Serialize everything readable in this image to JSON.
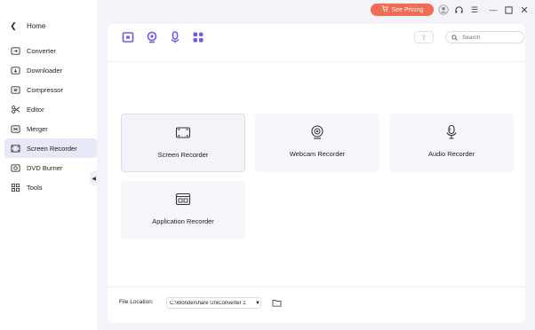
{
  "sidebar": {
    "home_label": "Home",
    "items": [
      {
        "label": "Converter",
        "icon": "converter-icon"
      },
      {
        "label": "Downloader",
        "icon": "downloader-icon"
      },
      {
        "label": "Compressor",
        "icon": "compressor-icon"
      },
      {
        "label": "Editor",
        "icon": "editor-icon"
      },
      {
        "label": "Merger",
        "icon": "merger-icon"
      },
      {
        "label": "Screen Recorder",
        "icon": "screen-recorder-icon",
        "active": true
      },
      {
        "label": "DVD Burner",
        "icon": "dvd-burner-icon"
      },
      {
        "label": "Tools",
        "icon": "tools-icon"
      }
    ]
  },
  "titlebar": {
    "pricing_label": "See Pricing"
  },
  "toolbar": {
    "search_placeholder": "Search"
  },
  "tiles": [
    {
      "label": "Screen Recorder",
      "icon": "screen-icon"
    },
    {
      "label": "Webcam Recorder",
      "icon": "webcam-icon"
    },
    {
      "label": "Audio Recorder",
      "icon": "microphone-icon"
    },
    {
      "label": "Application Recorder",
      "icon": "application-window-icon"
    }
  ],
  "footer": {
    "file_location_label": "File Location:",
    "file_location_value": "C:\\Wondershare UniConverter 1"
  },
  "colors": {
    "accent": "#6c5ce7",
    "pricing": "#f26c54",
    "active_bg": "#e7e8f8"
  }
}
